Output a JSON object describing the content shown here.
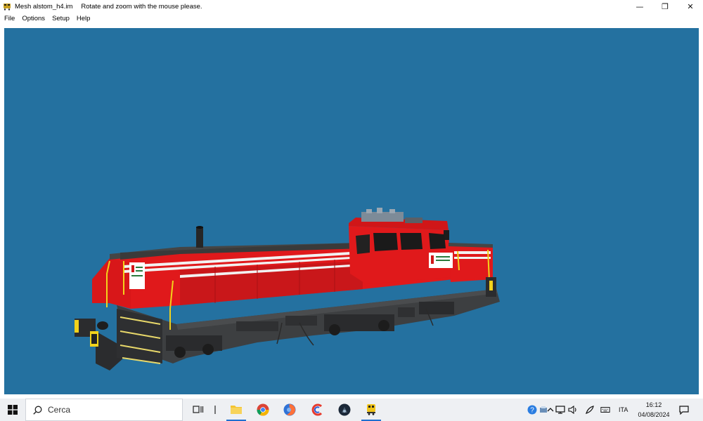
{
  "window": {
    "title": "Mesh alstom_h4.im",
    "hint": "Rotate and zoom with the mouse please.",
    "minimize_glyph": "—",
    "maximize_glyph": "❐",
    "close_glyph": "✕"
  },
  "menu": {
    "items": [
      {
        "label": "File"
      },
      {
        "label": "Options"
      },
      {
        "label": "Setup"
      },
      {
        "label": "Help"
      }
    ]
  },
  "viewport": {
    "background": "#2471a0",
    "model_colors": {
      "body": "#e0191b",
      "frame": "#3d3f41",
      "roof": "#454545",
      "trim": "#f2d21b"
    }
  },
  "taskbar": {
    "search_placeholder": "Cerca",
    "apps": [
      {
        "name": "task-view-icon"
      },
      {
        "name": "file-explorer-icon"
      },
      {
        "name": "chrome-icon"
      },
      {
        "name": "firefox-icon"
      },
      {
        "name": "ccleaner-icon"
      },
      {
        "name": "steam-icon"
      },
      {
        "name": "train-app-icon"
      }
    ],
    "tray": {
      "language": "ITA",
      "time": "16:12",
      "date": "04/08/2024"
    }
  }
}
